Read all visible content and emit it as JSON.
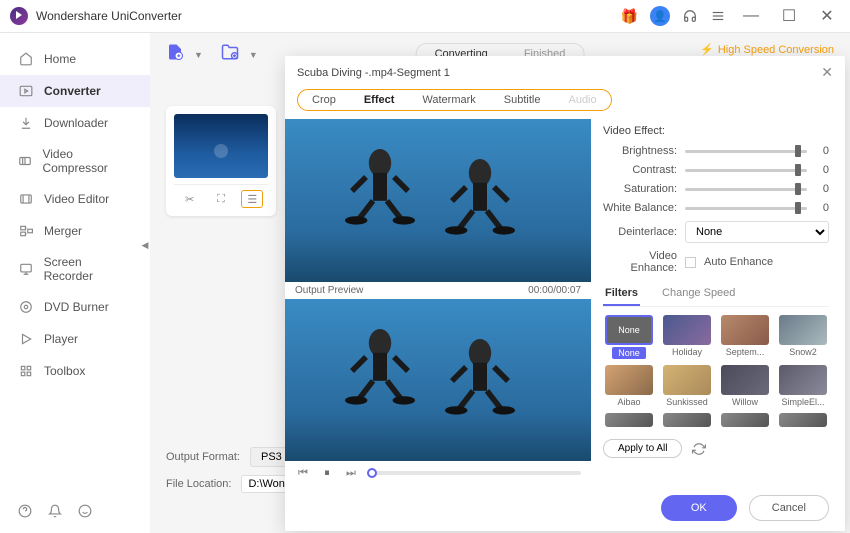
{
  "app": {
    "title": "Wondershare UniConverter"
  },
  "sidebar": {
    "items": [
      {
        "label": "Home"
      },
      {
        "label": "Converter"
      },
      {
        "label": "Downloader"
      },
      {
        "label": "Video Compressor"
      },
      {
        "label": "Video Editor"
      },
      {
        "label": "Merger"
      },
      {
        "label": "Screen Recorder"
      },
      {
        "label": "DVD Burner"
      },
      {
        "label": "Player"
      },
      {
        "label": "Toolbox"
      }
    ]
  },
  "content": {
    "tabs": {
      "converting": "Converting",
      "finished": "Finished"
    },
    "high_speed": "High Speed Conversion",
    "output_format_label": "Output Format:",
    "output_format_value": "PS3",
    "file_location_label": "File Location:",
    "file_location_value": "D:\\Wonders"
  },
  "modal": {
    "title": "Scuba Diving -.mp4-Segment 1",
    "tabs": {
      "crop": "Crop",
      "effect": "Effect",
      "watermark": "Watermark",
      "subtitle": "Subtitle",
      "audio": "Audio"
    },
    "preview_label": "Output Preview",
    "time": "00:00/00:07",
    "video_effect_title": "Video Effect:",
    "sliders": {
      "brightness": {
        "label": "Brightness:",
        "value": "0"
      },
      "contrast": {
        "label": "Contrast:",
        "value": "0"
      },
      "saturation": {
        "label": "Saturation:",
        "value": "0"
      },
      "white_balance": {
        "label": "White Balance:",
        "value": "0"
      }
    },
    "deinterlace": {
      "label": "Deinterlace:",
      "value": "None"
    },
    "enhance": {
      "label": "Video Enhance:",
      "checkbox_label": "Auto Enhance"
    },
    "sub_tabs": {
      "filters": "Filters",
      "change_speed": "Change Speed"
    },
    "filters": [
      {
        "label": "None",
        "cls": "none"
      },
      {
        "label": "Holiday",
        "cls": "holiday"
      },
      {
        "label": "Septem...",
        "cls": "sept"
      },
      {
        "label": "Snow2",
        "cls": "snow"
      },
      {
        "label": "Aibao",
        "cls": "aibao"
      },
      {
        "label": "Sunkissed",
        "cls": "sunkissed"
      },
      {
        "label": "Willow",
        "cls": "willow"
      },
      {
        "label": "SimpleEl...",
        "cls": "simple"
      }
    ],
    "apply_all": "Apply to All",
    "ok": "OK",
    "cancel": "Cancel"
  }
}
